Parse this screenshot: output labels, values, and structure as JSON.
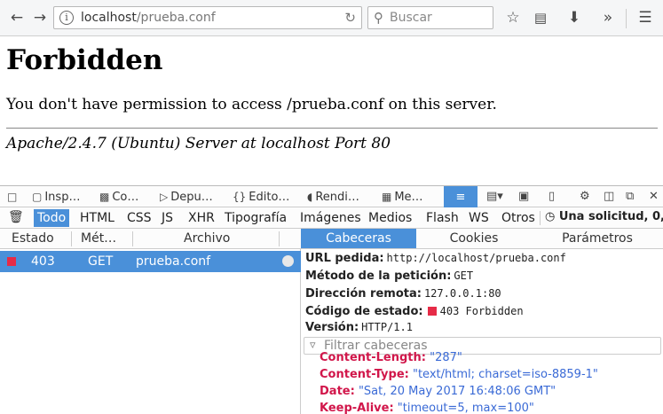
{
  "browser": {
    "url_host": "localhost",
    "url_path": "/prueba.conf",
    "search_placeholder": "Buscar"
  },
  "page": {
    "heading": "Forbidden",
    "message": "You don't have permission to access /prueba.conf on this server.",
    "address": "Apache/2.4.7 (Ubuntu) Server at localhost Port 80"
  },
  "devtools": {
    "tabs": [
      "Insp…",
      "Co…",
      "Depu…",
      "Edito…",
      "Rendi…",
      "Me…"
    ],
    "filters": [
      "Todo",
      "HTML",
      "CSS",
      "JS",
      "XHR",
      "Tipografía",
      "Imágenes",
      "Medios",
      "Flash",
      "WS",
      "Otros"
    ],
    "summary": "Una solicitud, 0,",
    "columns": {
      "status": "Estado",
      "method": "Mét…",
      "file": "Archivo"
    },
    "request": {
      "status": "403",
      "method": "GET",
      "file": "prueba.conf"
    },
    "side_tabs": [
      "Cabeceras",
      "Cookies",
      "Parámetros"
    ],
    "details": {
      "url_label": "URL pedida:",
      "url_value": "http://localhost/prueba.conf",
      "method_label": "Método de la petición:",
      "method_value": "GET",
      "remote_label": "Dirección remota:",
      "remote_value": "127.0.0.1:80",
      "status_label": "Código de estado:",
      "status_value": "403 Forbidden",
      "version_label": "Versión:",
      "version_value": "HTTP/1.1",
      "filter_placeholder": "Filtrar cabeceras"
    },
    "response_headers": [
      {
        "name": "Content-Length:",
        "value": "\"287\""
      },
      {
        "name": "Content-Type:",
        "value": "\"text/html; charset=iso-8859-1\""
      },
      {
        "name": "Date:",
        "value": "\"Sat, 20 May 2017 16:48:06 GMT\""
      },
      {
        "name": "Keep-Alive:",
        "value": "\"timeout=5, max=100\""
      }
    ]
  },
  "colors": {
    "accent": "#4a90d9",
    "status_error": "#e62b47",
    "header_name": "#d1164a",
    "header_value": "#3a6ad6"
  }
}
